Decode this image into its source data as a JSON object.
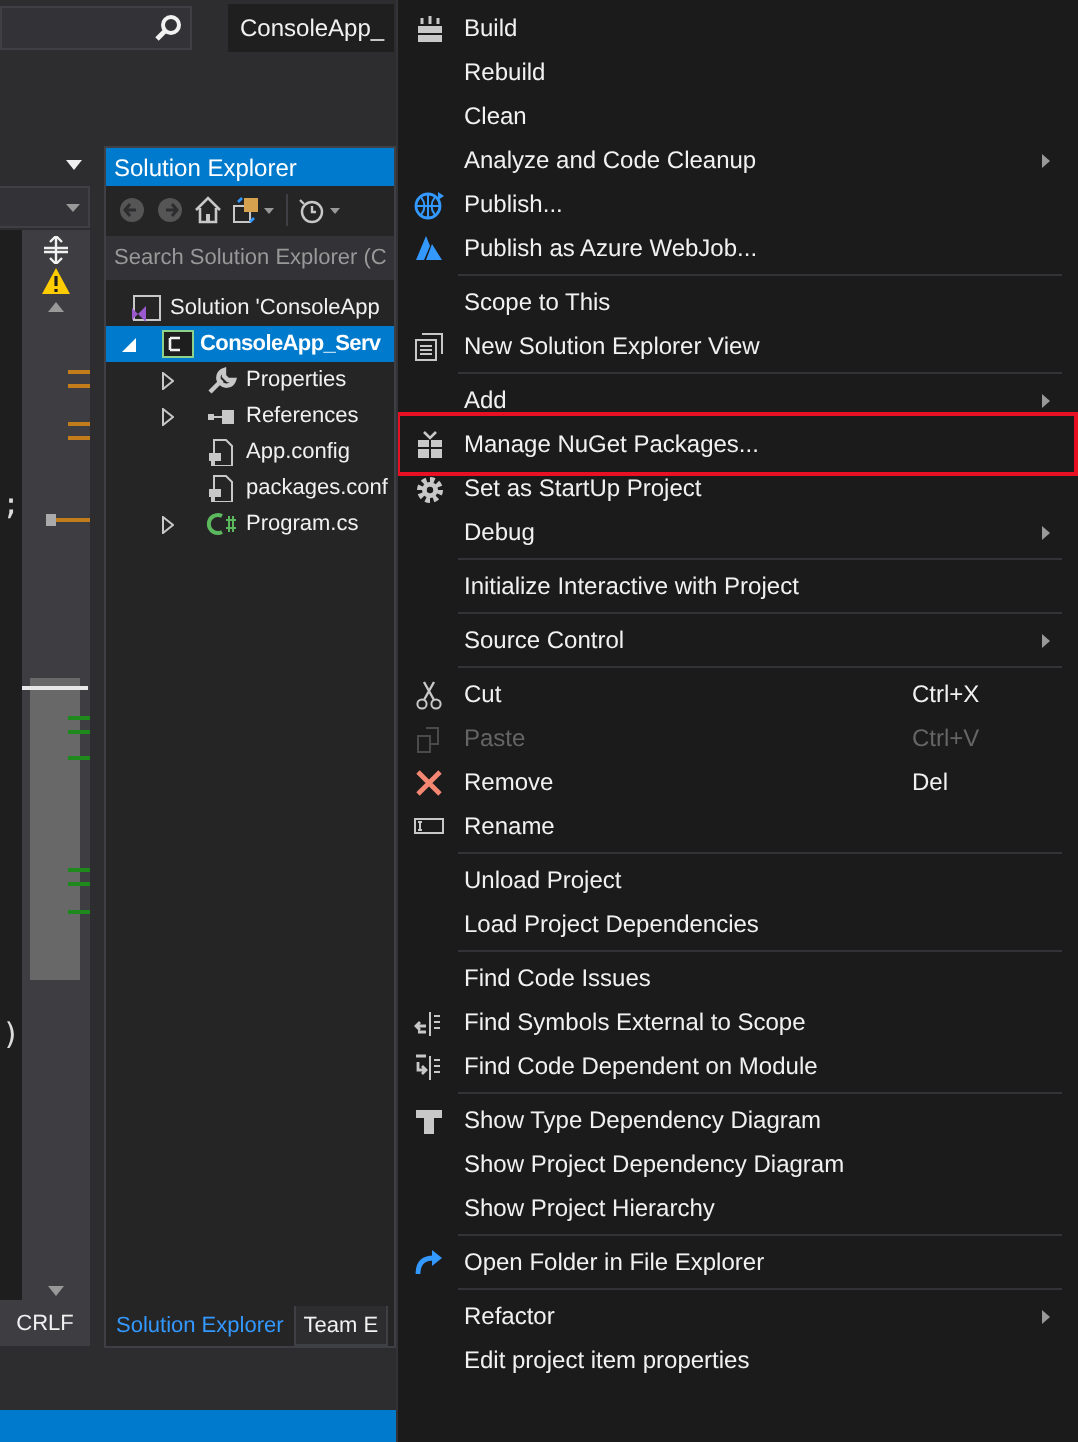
{
  "top_bar": {
    "project_field": "ConsoleApp_"
  },
  "editor": {
    "code_lines": [
      ";",
      ")"
    ],
    "line_ending": "CRLF"
  },
  "solution_explorer": {
    "title": "Solution Explorer",
    "search": {
      "placeholder": "Search Solution Explorer (C"
    },
    "tree": [
      {
        "label": "Solution 'ConsoleApp",
        "kind": "solution",
        "selected": false,
        "children": [
          {
            "label": "ConsoleApp_Serv",
            "kind": "project",
            "expanded": true,
            "selected": true,
            "children": [
              {
                "label": "Properties",
                "kind": "properties",
                "expanded": false,
                "selected": false
              },
              {
                "label": "References",
                "kind": "references",
                "expanded": false,
                "selected": false
              },
              {
                "label": "App.config",
                "kind": "config",
                "selected": false
              },
              {
                "label": "packages.conf",
                "kind": "config",
                "selected": false
              },
              {
                "label": "Program.cs",
                "kind": "csharp",
                "expanded": false,
                "selected": false
              }
            ]
          }
        ]
      }
    ],
    "tabs": [
      {
        "label": "Solution Explorer",
        "selected": true
      },
      {
        "label": "Team E",
        "selected": false
      }
    ]
  },
  "context_menu": {
    "groups": [
      [
        {
          "label": "Build",
          "submenu": false,
          "disabled": false,
          "highlighted": false
        },
        {
          "label": "Rebuild",
          "submenu": false,
          "disabled": false,
          "highlighted": false
        },
        {
          "label": "Clean",
          "submenu": false,
          "disabled": false,
          "highlighted": false
        },
        {
          "label": "Analyze and Code Cleanup",
          "submenu": true,
          "disabled": false,
          "highlighted": false
        },
        {
          "label": "Publish...",
          "submenu": false,
          "disabled": false,
          "highlighted": false
        },
        {
          "label": "Publish as Azure WebJob...",
          "submenu": false,
          "disabled": false,
          "highlighted": false
        }
      ],
      [
        {
          "label": "Scope to This",
          "submenu": false,
          "disabled": false,
          "highlighted": false
        },
        {
          "label": "New Solution Explorer View",
          "submenu": false,
          "disabled": false,
          "highlighted": false
        }
      ],
      [
        {
          "label": "Add",
          "submenu": true,
          "disabled": false,
          "highlighted": false
        },
        {
          "label": "Manage NuGet Packages...",
          "submenu": false,
          "disabled": false,
          "highlighted": true
        },
        {
          "label": "Set as StartUp Project",
          "submenu": false,
          "disabled": false,
          "highlighted": false
        },
        {
          "label": "Debug",
          "submenu": true,
          "disabled": false,
          "highlighted": false
        }
      ],
      [
        {
          "label": "Initialize Interactive with Project",
          "submenu": false,
          "disabled": false,
          "highlighted": false
        }
      ],
      [
        {
          "label": "Source Control",
          "submenu": true,
          "disabled": false,
          "highlighted": false
        }
      ],
      [
        {
          "label": "Cut",
          "shortcut": "Ctrl+X",
          "submenu": false,
          "disabled": false,
          "highlighted": false
        },
        {
          "label": "Paste",
          "shortcut": "Ctrl+V",
          "submenu": false,
          "disabled": true,
          "highlighted": false
        },
        {
          "label": "Remove",
          "shortcut": "Del",
          "submenu": false,
          "disabled": false,
          "highlighted": false
        },
        {
          "label": "Rename",
          "submenu": false,
          "disabled": false,
          "highlighted": false
        }
      ],
      [
        {
          "label": "Unload Project",
          "submenu": false,
          "disabled": false,
          "highlighted": false
        },
        {
          "label": "Load Project Dependencies",
          "submenu": false,
          "disabled": false,
          "highlighted": false
        }
      ],
      [
        {
          "label": "Find Code Issues",
          "submenu": false,
          "disabled": false,
          "highlighted": false
        },
        {
          "label": "Find Symbols External to Scope",
          "submenu": false,
          "disabled": false,
          "highlighted": false
        },
        {
          "label": "Find Code Dependent on Module",
          "submenu": false,
          "disabled": false,
          "highlighted": false
        }
      ],
      [
        {
          "label": "Show Type Dependency Diagram",
          "submenu": false,
          "disabled": false,
          "highlighted": false
        },
        {
          "label": "Show Project Dependency Diagram",
          "submenu": false,
          "disabled": false,
          "highlighted": false
        },
        {
          "label": "Show Project Hierarchy",
          "submenu": false,
          "disabled": false,
          "highlighted": false
        }
      ],
      [
        {
          "label": "Open Folder in File Explorer",
          "submenu": false,
          "disabled": false,
          "highlighted": false
        }
      ],
      [
        {
          "label": "Refactor",
          "submenu": true,
          "disabled": false,
          "highlighted": false
        },
        {
          "label": "Edit project item properties",
          "submenu": false,
          "disabled": false,
          "highlighted": false
        }
      ]
    ]
  }
}
